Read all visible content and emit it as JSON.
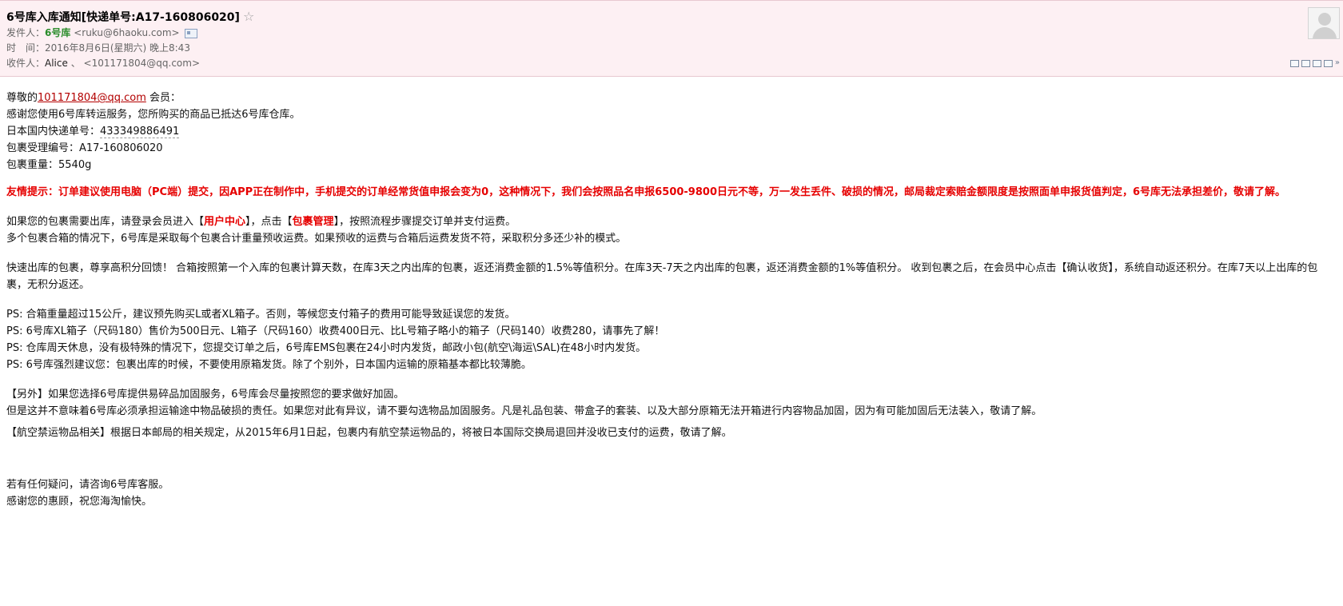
{
  "email": {
    "subject": "6号库入库通知[快递单号:A17-160806020]",
    "star_glyph": "☆",
    "from_label": "发件人：",
    "from_name": "6号库",
    "from_address": "<ruku@6haoku.com>",
    "time_label": "时　间：",
    "time_value": "2016年8月6日(星期六) 晚上8:43",
    "to_label": "收件人：",
    "to_name": "Alice",
    "to_sep": " 、 ",
    "to_address": "<101171804@qq.com>"
  },
  "body": {
    "greet_prefix": "尊敬的",
    "greet_email": "101171804@qq.com",
    "greet_suffix": " 会员：",
    "line_thanks": "感谢您使用6号库转运服务，您所购买的商品已抵达6号库仓库。",
    "tracking_label": "日本国内快递单号：",
    "tracking_value": "433349886491",
    "package_label": "包裹受理编号：",
    "package_value": "A17-160806020",
    "weight_label": "包裹重量：",
    "weight_value": "5540g",
    "warning": "友情提示：订单建议使用电脑（PC端）提交，因APP正在制作中，手机提交的订单经常货值申报会变为0，这种情况下，我们会按照品名申报6500-9800日元不等，万一发生丢件、破损的情况，邮局裁定索赔金额限度是按照面单申报货值判定，6号库无法承担差价，敬请了解。",
    "outbound_1a": "如果您的包裹需要出库，请登录会员进入【",
    "outbound_1b": "用户中心",
    "outbound_1c": "】，点击【",
    "outbound_1d": "包裹管理",
    "outbound_1e": "】，按照流程步骤提交订单并支付运费。",
    "outbound_2": "多个包裹合箱的情况下，6号库是采取每个包裹合计重量预收运费。如果预收的运费与合箱后运费发货不符，采取积分多还少补的模式。",
    "points": "快速出库的包裹，尊享高积分回馈！ 合箱按照第一个入库的包裹计算天数，在库3天之内出库的包裹，返还消费金额的1.5%等值积分。在库3天-7天之内出库的包裹，返还消费金额的1%等值积分。 收到包裹之后，在会员中心点击【确认收货】，系统自动返还积分。在库7天以上出库的包裹，无积分返还。",
    "ps1": "PS: 合箱重量超过15公斤，建议预先购买L或者XL箱子。否则，等候您支付箱子的费用可能导致延误您的发货。",
    "ps2": "PS: 6号库XL箱子（尺码180）售价为500日元、L箱子（尺码160）收费400日元、比L号箱子略小的箱子（尺码140）收费280，请事先了解！",
    "ps3": "PS: 仓库周天休息，没有极特殊的情况下，您提交订单之后，6号库EMS包裹在24小时内发货，邮政小包(航空\\海运\\SAL)在48小时内发货。",
    "ps4": "PS: 6号库强烈建议您：包裹出库的时候，不要使用原箱发货。除了个别外，日本国内运输的原箱基本都比较薄脆。",
    "extra_1": "【另外】如果您选择6号库提供易碎品加固服务，6号库会尽量按照您的要求做好加固。",
    "extra_2": "但是这并不意味着6号库必须承担运输途中物品破损的责任。如果您对此有异议，请不要勾选物品加固服务。凡是礼品包装、带盒子的套装、以及大部分原箱无法开箱进行内容物品加固，因为有可能加固后无法装入，敬请了解。",
    "aviation": "【航空禁运物品相关】根据日本邮局的相关规定，从2015年6月1日起，包裹内有航空禁运物品的，将被日本国际交换局退回并没收已支付的运费，敬请了解。",
    "closing_1": "若有任何疑问，请咨询6号库客服。",
    "closing_2": "感谢您的惠顾，祝您海淘愉快。"
  },
  "icons": {
    "star": "star-outline-icon",
    "contact_card": "contact-card-icon",
    "avatar": "avatar-placeholder",
    "toolbar": [
      "popout-icon",
      "window-icon",
      "attach-icon",
      "print-icon",
      "more-chevron-icon"
    ]
  },
  "colors": {
    "header_bg": "#fdf0f3",
    "sender_name": "#2a8c2a",
    "warning_red": "#e60000",
    "link_red": "#b30000"
  }
}
